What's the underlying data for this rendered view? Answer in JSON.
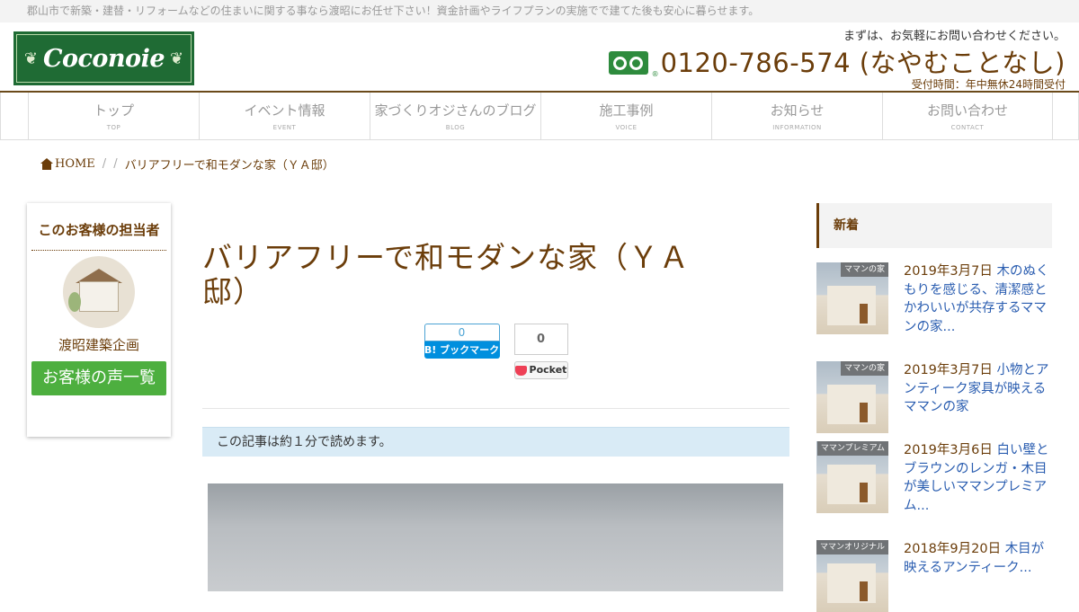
{
  "topbar": {
    "text": "郡山市で新築・建替・リフォームなどの住まいに関する事なら渡昭にお任せ下さい！資金計画やライフプランの実施でで建てた後も安心に暮らせます。"
  },
  "logo": {
    "text": "Coconoie"
  },
  "contact": {
    "note": "まずは、お気軽にお問い合わせください。",
    "phone": "0120-786-574 (なやむことなし)",
    "hours": "受付時間：年中無休24時間受付"
  },
  "nav": [
    {
      "label": "トップ",
      "sub": "TOP"
    },
    {
      "label": "イベント情報",
      "sub": "EVENT"
    },
    {
      "label": "家づくりオジさんのブログ",
      "sub": "BLOG"
    },
    {
      "label": "施工事例",
      "sub": "VOICE"
    },
    {
      "label": "お知らせ",
      "sub": "INFORMATION"
    },
    {
      "label": "お問い合わせ",
      "sub": "CONTACT"
    }
  ],
  "breadcrumb": {
    "home": "HOME",
    "sep1": "/",
    "sep2": "/",
    "current": "バリアフリーで和モダンな家（ＹＡ邸）"
  },
  "staff": {
    "title": "このお客様の担当者",
    "name": "渡昭建築企画",
    "button": "お客様の声一覧"
  },
  "post": {
    "title": "バリアフリーで和モダンな家（ＹＡ邸）",
    "readtime": "この記事は約１分で読めます。"
  },
  "share": {
    "hatena_count": "0",
    "hatena_label": "B! ブックマーク",
    "pocket_count": "0",
    "pocket_label": "Pocket"
  },
  "sidebar": {
    "heading": "新着",
    "posts": [
      {
        "tag": "ママンの家",
        "date": "2019年3月7日",
        "title": "木のぬくもりを感じる、清潔感とかわいいが共存するママンの家..."
      },
      {
        "tag": "ママンの家",
        "date": "2019年3月7日",
        "title": "小物とアンティーク家具が映えるママンの家"
      },
      {
        "tag": "ママンプレミアム",
        "date": "2019年3月6日",
        "title": "白い壁とブラウンのレンガ・木目が美しいママンプレミアム..."
      },
      {
        "tag": "ママンオリジナル",
        "date": "2018年9月20日",
        "title": "木目が映えるアンティーク..."
      }
    ]
  }
}
